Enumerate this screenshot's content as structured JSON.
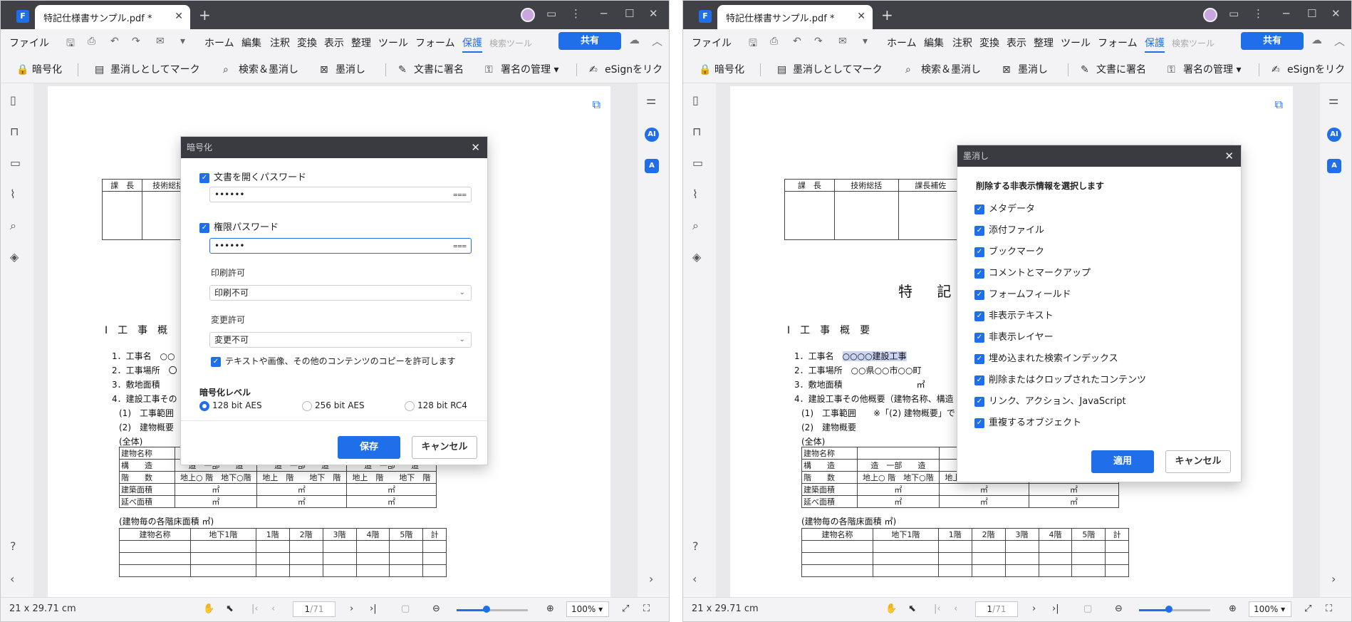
{
  "window": {
    "tab_title": "特記仕様書サンプル.pdf *",
    "tab_close": "✕",
    "new_tab": "+",
    "share_label": "共有"
  },
  "menu": [
    "ファイル",
    "ホーム",
    "編集",
    "注釈",
    "変換",
    "表示",
    "整理",
    "ツール",
    "フォーム",
    "保護",
    "検索ツール"
  ],
  "toolbar": {
    "encrypt": "暗号化",
    "mark_redaction": "墨消しとしてマーク",
    "search_redact": "検索＆墨消し",
    "redact": "墨消し",
    "sign_doc": "文書に署名",
    "sig_manage": "署名の管理",
    "esign": "eSignをリク"
  },
  "status": {
    "page_size": "21 x 29.71 cm",
    "page_current": "1",
    "page_total": "/71",
    "zoom": "100%"
  },
  "doc": {
    "title": "特 記",
    "section": "Ⅰ　工　事　概　要",
    "section_short": "Ⅰ　工　事　概",
    "item1_label": "1．工事名",
    "item1_value": "○○○○建設工事",
    "item1_short": "1．工事名　○○",
    "item2_label": "2．工事場所　○○県○○市○○町",
    "item2_short": "2．工事場所　〇",
    "item3": "3．敷地面積",
    "item3_unit": "㎡",
    "item4": "4．建設工事その他概要（建物名称、構造",
    "item4_short": "4．建設工事その",
    "sub1": "(1)　工事範囲",
    "sub1_note": "※「(2) 建物概要」で",
    "sub2": "(2)　建物概要",
    "zentai": "(全体)",
    "floor_caption": "(建物毎の各階床面積 ㎡)",
    "approval_headers": [
      "課　長",
      "技術総括",
      "課長補佐"
    ],
    "bldg_rows": [
      {
        "label": "建物名称",
        "cells": [
          "",
          "",
          ""
        ]
      },
      {
        "label": "構　　造",
        "cells": [
          "造　一部　　造",
          "造　一部　　造",
          "造　一部　　造"
        ]
      },
      {
        "label": "階　　数",
        "cells": [
          "地上○ 階　地下○階",
          "地上　階　　地下　階",
          "地上　階　　地下　階"
        ]
      },
      {
        "label": "建築面積",
        "cells": [
          "㎡",
          "㎡",
          "㎡"
        ]
      },
      {
        "label": "延べ面積",
        "cells": [
          "㎡",
          "㎡",
          "㎡"
        ]
      }
    ],
    "floor_headers": [
      "建物名称",
      "地下1階",
      "1階",
      "2階",
      "3階",
      "4階",
      "5階",
      "計"
    ]
  },
  "encrypt_dialog": {
    "title": "暗号化",
    "open_pw_label": "文書を開くパスワード",
    "open_pw_value": "••••••",
    "perm_pw_label": "権限パスワード",
    "perm_pw_value": "••••••",
    "print_label": "印刷許可",
    "print_value": "印刷不可",
    "change_label": "変更許可",
    "change_value": "変更不可",
    "copy_label": "テキストや画像、その他のコンテンツのコピーを許可します",
    "level_label": "暗号化レベル",
    "levels": [
      "128 bit AES",
      "256 bit AES",
      "128 bit RC4"
    ],
    "save": "保存",
    "cancel": "キャンセル"
  },
  "redact_dialog": {
    "title": "墨消し",
    "heading": "削除する非表示情報を選択します",
    "items": [
      "メタデータ",
      "添付ファイル",
      "ブックマーク",
      "コメントとマークアップ",
      "フォームフィールド",
      "非表示テキスト",
      "非表示レイヤー",
      "埋め込まれた検索インデックス",
      "削除またはクロップされたコンテンツ",
      "リンク、アクション、JavaScript",
      "重複するオブジェクト"
    ],
    "apply": "適用",
    "cancel": "キャンセル"
  },
  "colors": {
    "accent": "#1f6feb",
    "titlebar": "#3f4147",
    "dialog_header": "#3a3b40"
  }
}
